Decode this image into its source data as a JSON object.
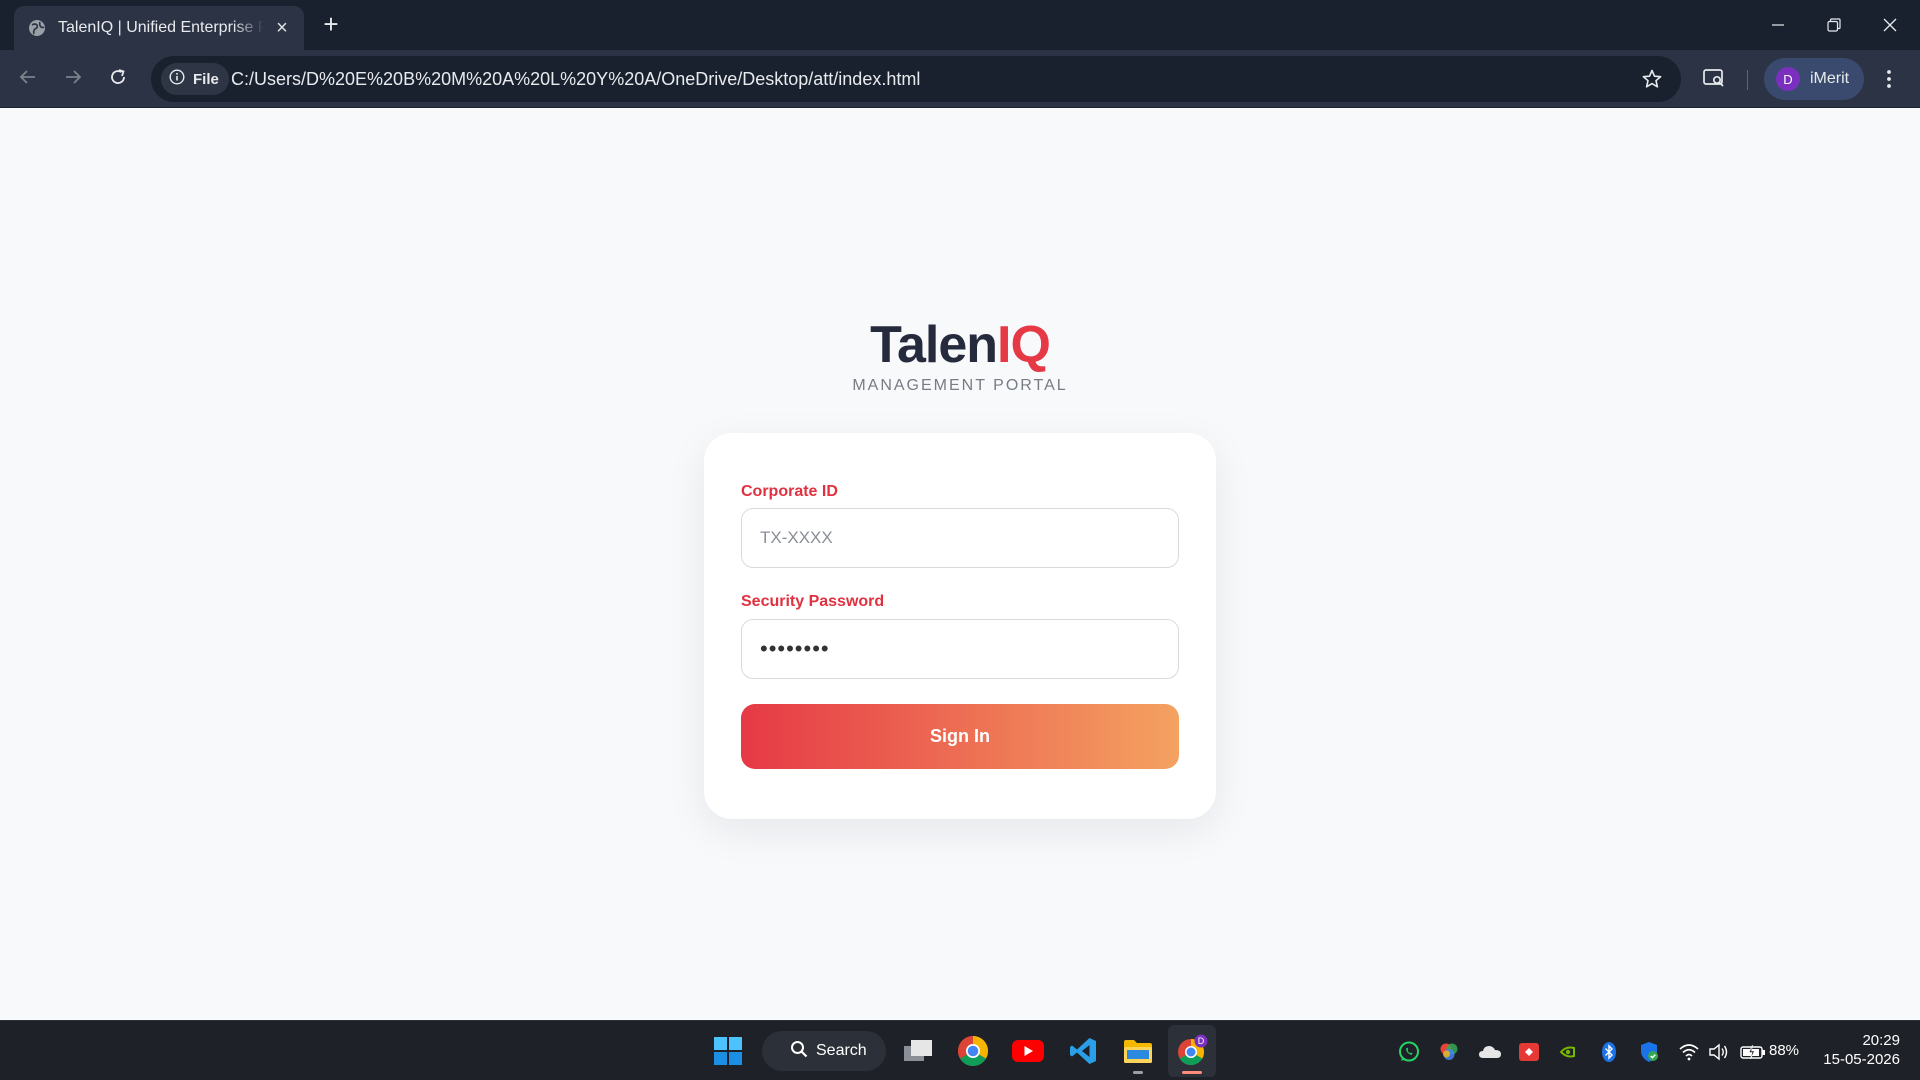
{
  "browser": {
    "tab_title": "TalenIQ | Unified Enterprise Portal",
    "security_chip": "File",
    "url": "C:/Users/D%20E%20B%20M%20A%20L%20Y%20A/OneDrive/Desktop/att/index.html",
    "profile_initial": "D",
    "profile_name": "iMerit"
  },
  "brand": {
    "logo_part1": "Talen",
    "logo_part2": "IQ",
    "subtitle": "MANAGEMENT PORTAL"
  },
  "login": {
    "corporate_id_label": "Corporate ID",
    "corporate_id_placeholder": "TX-XXXX",
    "corporate_id_value": "",
    "password_label": "Security Password",
    "password_value": "••••••••",
    "signin_label": "Sign In"
  },
  "taskbar": {
    "search_label": "Search",
    "icons": [
      "windows-start-icon",
      "search-icon",
      "task-view-icon",
      "chrome-icon",
      "youtube-icon",
      "vscode-icon",
      "file-explorer-icon",
      "chrome-profile-icon"
    ],
    "tray_icons": [
      "whatsapp-icon",
      "color-app-icon",
      "onedrive-icon",
      "screen-recorder-icon",
      "nvidia-icon",
      "bluetooth-icon",
      "security-shield-icon",
      "wifi-icon",
      "volume-icon",
      "battery-icon"
    ],
    "battery": "88%",
    "time": "20:29",
    "date": "15-05-2026"
  },
  "colors": {
    "accent_red": "#e63946",
    "accent_orange": "#f4a261",
    "logo_dark": "#262a3d",
    "chrome_dark": "#19212f"
  }
}
